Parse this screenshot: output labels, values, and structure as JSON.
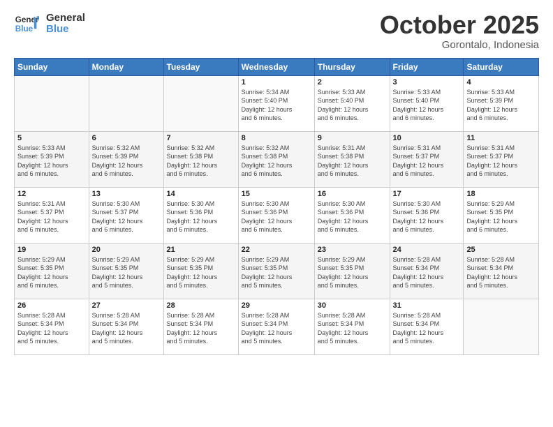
{
  "logo": {
    "line1": "General",
    "line2": "Blue"
  },
  "header": {
    "month": "October 2025",
    "location": "Gorontalo, Indonesia"
  },
  "weekdays": [
    "Sunday",
    "Monday",
    "Tuesday",
    "Wednesday",
    "Thursday",
    "Friday",
    "Saturday"
  ],
  "weeks": [
    [
      {
        "day": "",
        "info": ""
      },
      {
        "day": "",
        "info": ""
      },
      {
        "day": "",
        "info": ""
      },
      {
        "day": "1",
        "info": "Sunrise: 5:34 AM\nSunset: 5:40 PM\nDaylight: 12 hours\nand 6 minutes."
      },
      {
        "day": "2",
        "info": "Sunrise: 5:33 AM\nSunset: 5:40 PM\nDaylight: 12 hours\nand 6 minutes."
      },
      {
        "day": "3",
        "info": "Sunrise: 5:33 AM\nSunset: 5:40 PM\nDaylight: 12 hours\nand 6 minutes."
      },
      {
        "day": "4",
        "info": "Sunrise: 5:33 AM\nSunset: 5:39 PM\nDaylight: 12 hours\nand 6 minutes."
      }
    ],
    [
      {
        "day": "5",
        "info": "Sunrise: 5:33 AM\nSunset: 5:39 PM\nDaylight: 12 hours\nand 6 minutes."
      },
      {
        "day": "6",
        "info": "Sunrise: 5:32 AM\nSunset: 5:39 PM\nDaylight: 12 hours\nand 6 minutes."
      },
      {
        "day": "7",
        "info": "Sunrise: 5:32 AM\nSunset: 5:38 PM\nDaylight: 12 hours\nand 6 minutes."
      },
      {
        "day": "8",
        "info": "Sunrise: 5:32 AM\nSunset: 5:38 PM\nDaylight: 12 hours\nand 6 minutes."
      },
      {
        "day": "9",
        "info": "Sunrise: 5:31 AM\nSunset: 5:38 PM\nDaylight: 12 hours\nand 6 minutes."
      },
      {
        "day": "10",
        "info": "Sunrise: 5:31 AM\nSunset: 5:37 PM\nDaylight: 12 hours\nand 6 minutes."
      },
      {
        "day": "11",
        "info": "Sunrise: 5:31 AM\nSunset: 5:37 PM\nDaylight: 12 hours\nand 6 minutes."
      }
    ],
    [
      {
        "day": "12",
        "info": "Sunrise: 5:31 AM\nSunset: 5:37 PM\nDaylight: 12 hours\nand 6 minutes."
      },
      {
        "day": "13",
        "info": "Sunrise: 5:30 AM\nSunset: 5:37 PM\nDaylight: 12 hours\nand 6 minutes."
      },
      {
        "day": "14",
        "info": "Sunrise: 5:30 AM\nSunset: 5:36 PM\nDaylight: 12 hours\nand 6 minutes."
      },
      {
        "day": "15",
        "info": "Sunrise: 5:30 AM\nSunset: 5:36 PM\nDaylight: 12 hours\nand 6 minutes."
      },
      {
        "day": "16",
        "info": "Sunrise: 5:30 AM\nSunset: 5:36 PM\nDaylight: 12 hours\nand 6 minutes."
      },
      {
        "day": "17",
        "info": "Sunrise: 5:30 AM\nSunset: 5:36 PM\nDaylight: 12 hours\nand 6 minutes."
      },
      {
        "day": "18",
        "info": "Sunrise: 5:29 AM\nSunset: 5:35 PM\nDaylight: 12 hours\nand 6 minutes."
      }
    ],
    [
      {
        "day": "19",
        "info": "Sunrise: 5:29 AM\nSunset: 5:35 PM\nDaylight: 12 hours\nand 6 minutes."
      },
      {
        "day": "20",
        "info": "Sunrise: 5:29 AM\nSunset: 5:35 PM\nDaylight: 12 hours\nand 5 minutes."
      },
      {
        "day": "21",
        "info": "Sunrise: 5:29 AM\nSunset: 5:35 PM\nDaylight: 12 hours\nand 5 minutes."
      },
      {
        "day": "22",
        "info": "Sunrise: 5:29 AM\nSunset: 5:35 PM\nDaylight: 12 hours\nand 5 minutes."
      },
      {
        "day": "23",
        "info": "Sunrise: 5:29 AM\nSunset: 5:35 PM\nDaylight: 12 hours\nand 5 minutes."
      },
      {
        "day": "24",
        "info": "Sunrise: 5:28 AM\nSunset: 5:34 PM\nDaylight: 12 hours\nand 5 minutes."
      },
      {
        "day": "25",
        "info": "Sunrise: 5:28 AM\nSunset: 5:34 PM\nDaylight: 12 hours\nand 5 minutes."
      }
    ],
    [
      {
        "day": "26",
        "info": "Sunrise: 5:28 AM\nSunset: 5:34 PM\nDaylight: 12 hours\nand 5 minutes."
      },
      {
        "day": "27",
        "info": "Sunrise: 5:28 AM\nSunset: 5:34 PM\nDaylight: 12 hours\nand 5 minutes."
      },
      {
        "day": "28",
        "info": "Sunrise: 5:28 AM\nSunset: 5:34 PM\nDaylight: 12 hours\nand 5 minutes."
      },
      {
        "day": "29",
        "info": "Sunrise: 5:28 AM\nSunset: 5:34 PM\nDaylight: 12 hours\nand 5 minutes."
      },
      {
        "day": "30",
        "info": "Sunrise: 5:28 AM\nSunset: 5:34 PM\nDaylight: 12 hours\nand 5 minutes."
      },
      {
        "day": "31",
        "info": "Sunrise: 5:28 AM\nSunset: 5:34 PM\nDaylight: 12 hours\nand 5 minutes."
      },
      {
        "day": "",
        "info": ""
      }
    ]
  ]
}
